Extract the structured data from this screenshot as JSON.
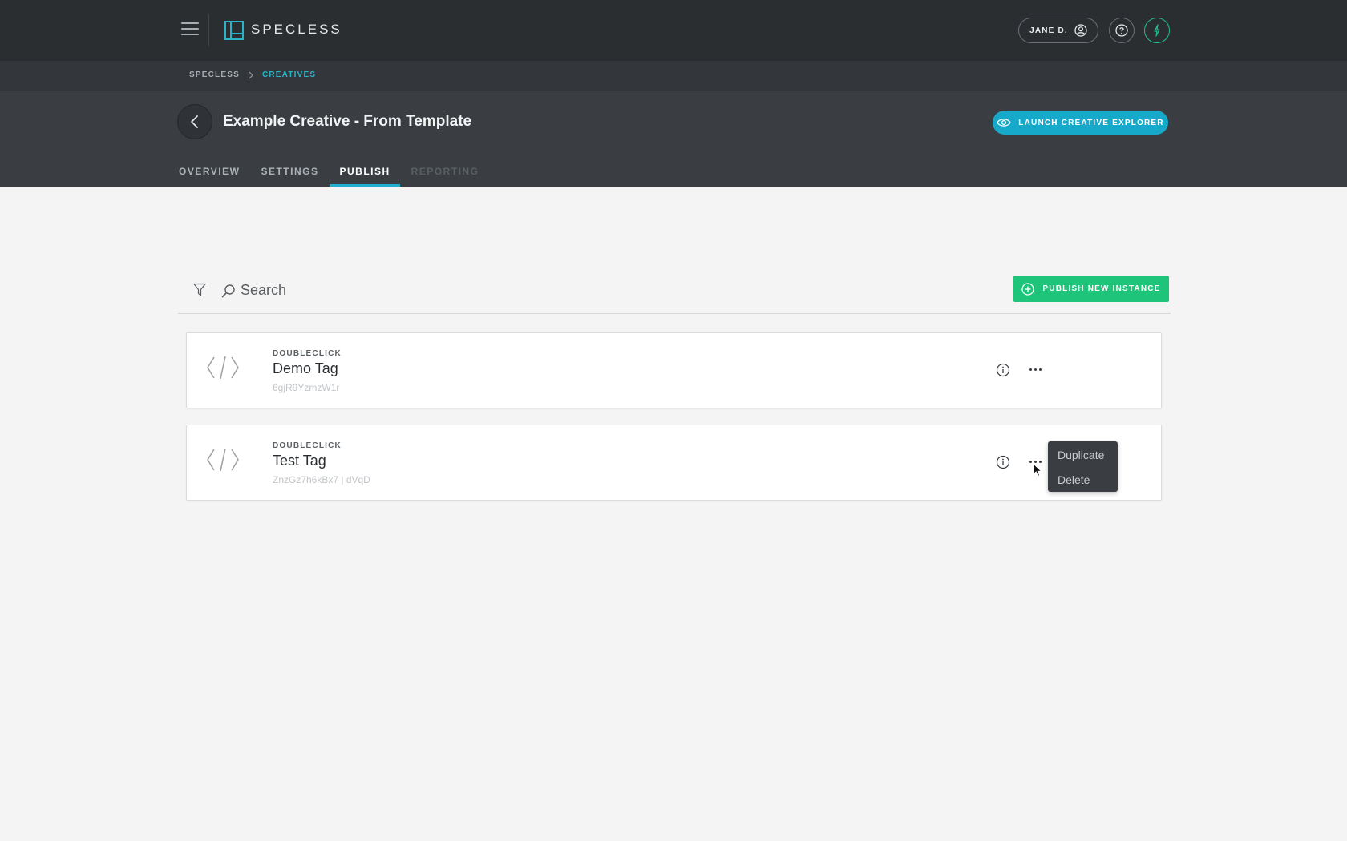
{
  "topbar": {
    "logo_text": "SPECLESS",
    "user_name": "JANE D.",
    "icons": [
      "hamburger-icon",
      "specless-logo-icon",
      "user-circle-icon",
      "help-icon",
      "bolt-icon"
    ],
    "accent_color": "#1fbf8f"
  },
  "breadcrumb": {
    "root": "SPECLESS",
    "current": "CREATIVES"
  },
  "header": {
    "title": "Example Creative - From Template",
    "launch_label": "LAUNCH CREATIVE EXPLORER",
    "launch_color": "#17a9c9",
    "tabs": [
      {
        "label": "OVERVIEW",
        "state": "normal"
      },
      {
        "label": "SETTINGS",
        "state": "normal"
      },
      {
        "label": "PUBLISH",
        "state": "active"
      },
      {
        "label": "REPORTING",
        "state": "disabled"
      }
    ]
  },
  "toolbar": {
    "search_placeholder": "Search",
    "publish_label": "PUBLISH NEW INSTANCE",
    "publish_color": "#1ec47a"
  },
  "instances": [
    {
      "platform": "DOUBLECLICK",
      "name": "Demo Tag",
      "id": "6gjR9YzmzW1r"
    },
    {
      "platform": "DOUBLECLICK",
      "name": "Test Tag",
      "id": "ZnzGz7h6kBx7 | dVqD"
    }
  ],
  "context_menu": {
    "items": [
      "Duplicate",
      "Delete"
    ]
  }
}
